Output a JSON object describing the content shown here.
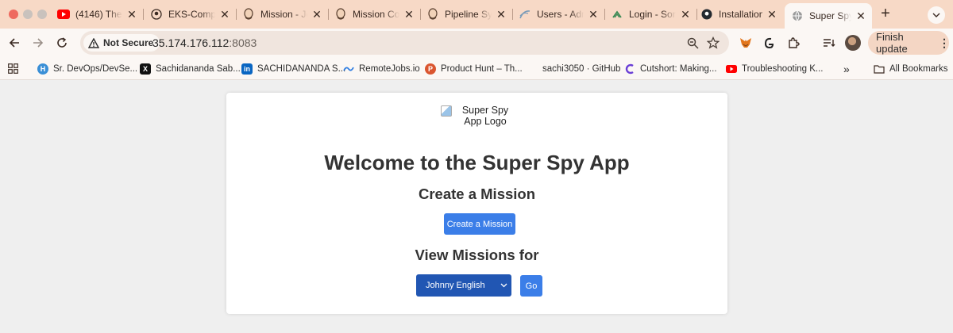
{
  "browser": {
    "tabs": [
      {
        "title": "(4146) The ",
        "icon": "youtube-icon"
      },
      {
        "title": "EKS-Compl",
        "icon": "github-icon"
      },
      {
        "title": "Mission - Je",
        "icon": "jenkins-icon"
      },
      {
        "title": "Mission Con",
        "icon": "jenkins-icon"
      },
      {
        "title": "Pipeline Syn",
        "icon": "jenkins-icon"
      },
      {
        "title": "Users - Adm",
        "icon": "sonarqube-icon"
      },
      {
        "title": "Login - Son",
        "icon": "sonarqube-icon"
      },
      {
        "title": "Installation",
        "icon": "github-icon"
      },
      {
        "title": "Super Spy A",
        "icon": "globe-icon",
        "active": true
      }
    ],
    "new_tab_label": "+",
    "security_label": "Not Secure",
    "url_host": "35.174.176.112",
    "url_port": ":8083",
    "finish_update_label": "Finish update",
    "bookmarks": [
      {
        "label": "Sr. DevOps/DevSe...",
        "icon": "hf-icon"
      },
      {
        "label": "Sachidananda Sab...",
        "icon": "x-icon"
      },
      {
        "label": "SACHIDANANDA S...",
        "icon": "linkedin-icon"
      },
      {
        "label": "RemoteJobs.io",
        "icon": "remotejobs-icon"
      },
      {
        "label": "Product Hunt – Th...",
        "icon": "producthunt-icon"
      },
      {
        "label": "sachi3050 · GitHub",
        "icon": "github-icon"
      },
      {
        "label": "Cutshort: Making...",
        "icon": "cutshort-icon"
      },
      {
        "label": "Troubleshooting K...",
        "icon": "youtube-icon"
      }
    ],
    "overflow_label": "»",
    "all_bookmarks_label": "All Bookmarks",
    "colors": {
      "tabstrip": "#f7d9c6",
      "toolbar": "#fbf7f4",
      "omnibox": "#f0e5de"
    }
  },
  "page": {
    "logo_alt": "Super Spy App Logo",
    "heading": "Welcome to the Super Spy App",
    "create_heading": "Create a Mission",
    "create_button": "Create a Mission",
    "view_heading": "View Missions for",
    "selected_agent": "Johnny English",
    "go_button": "Go",
    "colors": {
      "button": "#3b7ee8",
      "select": "#2156b3",
      "background": "#efefef",
      "card": "#ffffff"
    }
  }
}
